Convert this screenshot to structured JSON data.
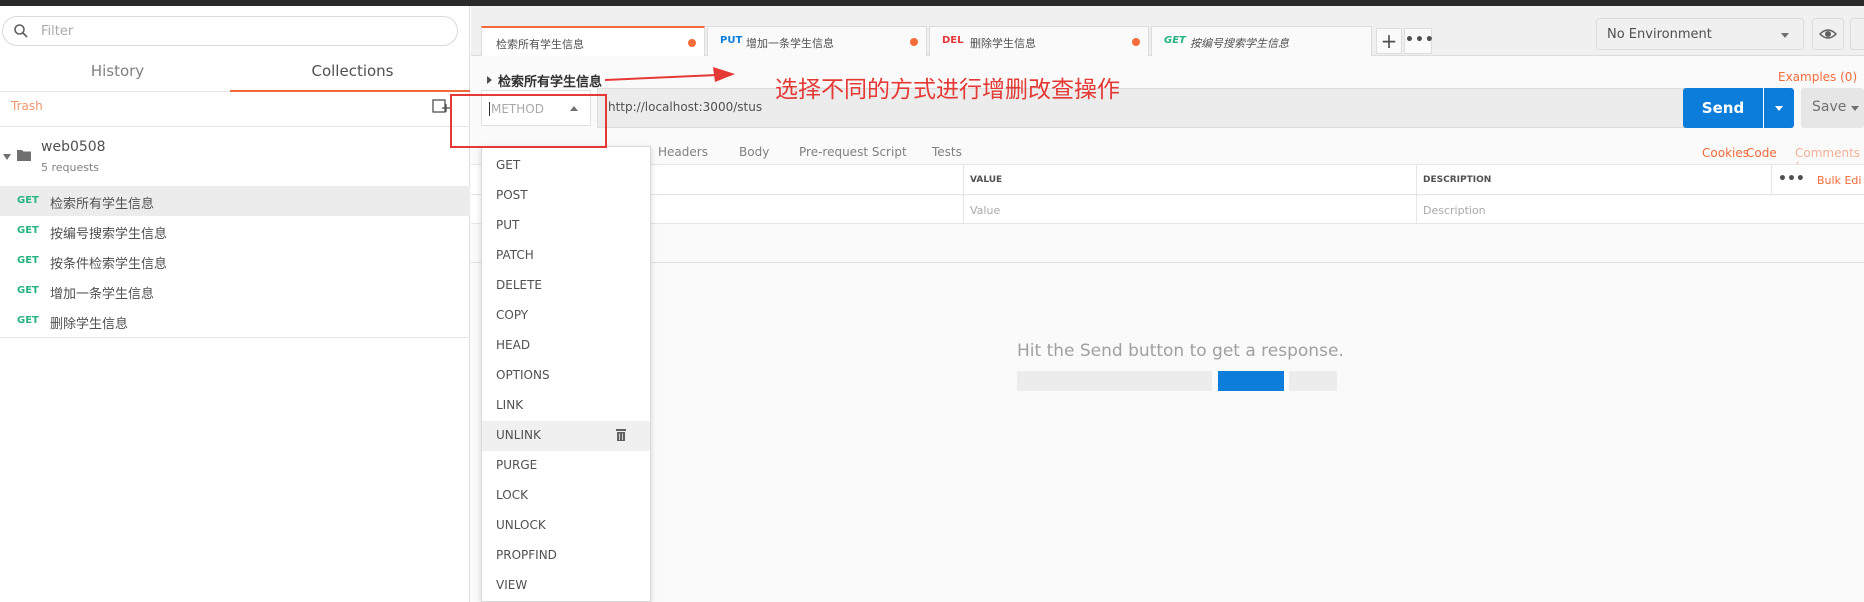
{
  "sidebar": {
    "filter_placeholder": "Filter",
    "tabs": [
      {
        "label": "History"
      },
      {
        "label": "Collections"
      }
    ],
    "trash_label": "Trash",
    "collection": {
      "name": "web0508",
      "count": "5 requests"
    },
    "requests": [
      {
        "method": "GET",
        "name": "检索所有学生信息"
      },
      {
        "method": "GET",
        "name": "按编号搜索学生信息"
      },
      {
        "method": "GET",
        "name": "按条件检索学生信息"
      },
      {
        "method": "GET",
        "name": "增加一条学生信息"
      },
      {
        "method": "GET",
        "name": "删除学生信息"
      }
    ]
  },
  "tabs": [
    {
      "method": "",
      "name": "检索所有学生信息",
      "method_color": "#26b47f"
    },
    {
      "method": "PUT",
      "name": "增加一条学生信息",
      "method_color": "#0d7ddb"
    },
    {
      "method": "DEL",
      "name": "删除学生信息",
      "method_color": "#e53935"
    },
    {
      "method": "GET",
      "name": "按编号搜索学生信息",
      "method_color": "#26b47f"
    }
  ],
  "environment": {
    "selected": "No Environment"
  },
  "request": {
    "name": "检索所有学生信息",
    "examples": "Examples (0)",
    "method_placeholder": "METHOD",
    "url": "http://localhost:3000/stus",
    "send_label": "Send",
    "save_label": "Save"
  },
  "subtabs": [
    "Headers",
    "Body",
    "Pre-request Script",
    "Tests"
  ],
  "links": {
    "cookies": "Cookies",
    "code": "Code",
    "comments": "Comments ("
  },
  "params_table": {
    "headers": [
      "VALUE",
      "DESCRIPTION"
    ],
    "placeholders": [
      "Value",
      "Description"
    ],
    "bulk_edit": "Bulk Edi"
  },
  "response": {
    "hint": "Hit the Send button to get a response."
  },
  "method_options": [
    "GET",
    "POST",
    "PUT",
    "PATCH",
    "DELETE",
    "COPY",
    "HEAD",
    "OPTIONS",
    "LINK",
    "UNLINK",
    "PURGE",
    "LOCK",
    "UNLOCK",
    "PROPFIND",
    "VIEW"
  ],
  "annotation": {
    "text": "选择不同的方式进行增删改查操作"
  },
  "colors": {
    "accent": "#f26b3a",
    "send": "#0d7ddb",
    "get": "#26b47f",
    "annotation": "#e53935"
  }
}
